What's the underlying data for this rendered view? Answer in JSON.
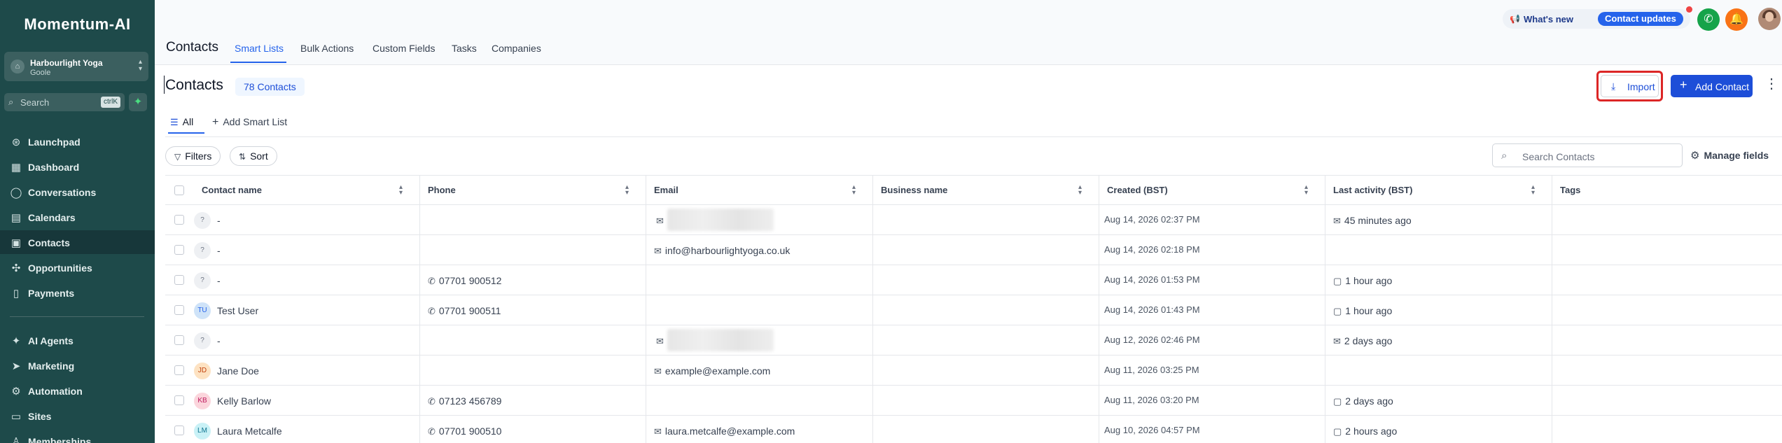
{
  "sidebar": {
    "logo": "Momentum-AI",
    "account": {
      "name": "Harbourlight Yoga",
      "sub": "Goole"
    },
    "search": {
      "placeholder": "Search",
      "shortcut": "ctrlK"
    },
    "items": [
      {
        "label": "Launchpad",
        "icon": "rocket-icon",
        "glyph": "⊛"
      },
      {
        "label": "Dashboard",
        "icon": "dashboard-icon",
        "glyph": "▦"
      },
      {
        "label": "Conversations",
        "icon": "chat-icon",
        "glyph": "◯"
      },
      {
        "label": "Calendars",
        "icon": "calendar-icon",
        "glyph": "▤"
      },
      {
        "label": "Contacts",
        "icon": "contacts-icon",
        "glyph": "▣",
        "active": true
      },
      {
        "label": "Opportunities",
        "icon": "opportunities-icon",
        "glyph": "✣"
      },
      {
        "label": "Payments",
        "icon": "payments-icon",
        "glyph": "▯"
      },
      {
        "label": "AI Agents",
        "icon": "ai-agents-icon",
        "glyph": "✦"
      },
      {
        "label": "Marketing",
        "icon": "marketing-icon",
        "glyph": "➤"
      },
      {
        "label": "Automation",
        "icon": "automation-icon",
        "glyph": "⚙"
      },
      {
        "label": "Sites",
        "icon": "sites-icon",
        "glyph": "▭"
      },
      {
        "label": "Memberships",
        "icon": "memberships-icon",
        "glyph": "♙"
      }
    ]
  },
  "topbar": {
    "title": "Contacts",
    "tabs": [
      "Smart Lists",
      "Bulk Actions",
      "Custom Fields",
      "Tasks",
      "Companies"
    ],
    "active_tab": "Smart Lists",
    "whats_new": "What's new",
    "contact_updates": "Contact updates"
  },
  "header": {
    "title": "Contacts",
    "count": "78 Contacts",
    "import_label": "Import",
    "add_contact_label": "Add Contact"
  },
  "lists": {
    "all": "All",
    "add_smart_list": "Add Smart List"
  },
  "filters": {
    "filters_label": "Filters",
    "sort_label": "Sort"
  },
  "search_contacts": {
    "placeholder": "Search Contacts"
  },
  "manage_fields": "Manage fields",
  "colors": {
    "sidebar": "#1e4a4a",
    "accent": "#2563eb",
    "highlight": "#dc2626"
  },
  "table": {
    "columns": [
      "Contact name",
      "Phone",
      "Email",
      "Business name",
      "Created (BST)",
      "Last activity (BST)",
      "Tags"
    ],
    "rows": [
      {
        "initials": "?",
        "name": "-",
        "phone": "",
        "email": "",
        "email_blurred": true,
        "created": "Aug 14, 2026 02:37 PM",
        "activity": "45 minutes ago",
        "activity_icon": "email"
      },
      {
        "initials": "?",
        "name": "-",
        "phone": "",
        "email": "info@harbourlightyoga.co.uk",
        "email_blurred": false,
        "created": "Aug 14, 2026 02:18 PM",
        "activity": "",
        "activity_icon": ""
      },
      {
        "initials": "?",
        "name": "-",
        "phone": "07701 900512",
        "email": "",
        "email_blurred": false,
        "created": "Aug 14, 2026 01:53 PM",
        "activity": "1 hour ago",
        "activity_icon": "chat"
      },
      {
        "initials": "TU",
        "name": "Test User",
        "phone": "07701 900511",
        "email": "",
        "email_blurred": false,
        "created": "Aug 14, 2026 01:43 PM",
        "activity": "1 hour ago",
        "activity_icon": "chat"
      },
      {
        "initials": "?",
        "name": "-",
        "phone": "",
        "email": "",
        "email_blurred": true,
        "created": "Aug 12, 2026 02:46 PM",
        "activity": "2 days ago",
        "activity_icon": "email"
      },
      {
        "initials": "JD",
        "name": "Jane Doe",
        "phone": "",
        "email": "example@example.com",
        "email_blurred": false,
        "created": "Aug 11, 2026 03:25 PM",
        "activity": "",
        "activity_icon": ""
      },
      {
        "initials": "KB",
        "name": "Kelly Barlow",
        "phone": "07123 456789",
        "email": "",
        "email_blurred": false,
        "created": "Aug 11, 2026 03:20 PM",
        "activity": "2 days ago",
        "activity_icon": "chat"
      },
      {
        "initials": "LM",
        "name": "Laura Metcalfe",
        "phone": "07701 900510",
        "email": "laura.metcalfe@example.com",
        "email_blurred": false,
        "created": "Aug 10, 2026 04:57 PM",
        "activity": "2 hours ago",
        "activity_icon": "chat"
      }
    ]
  }
}
